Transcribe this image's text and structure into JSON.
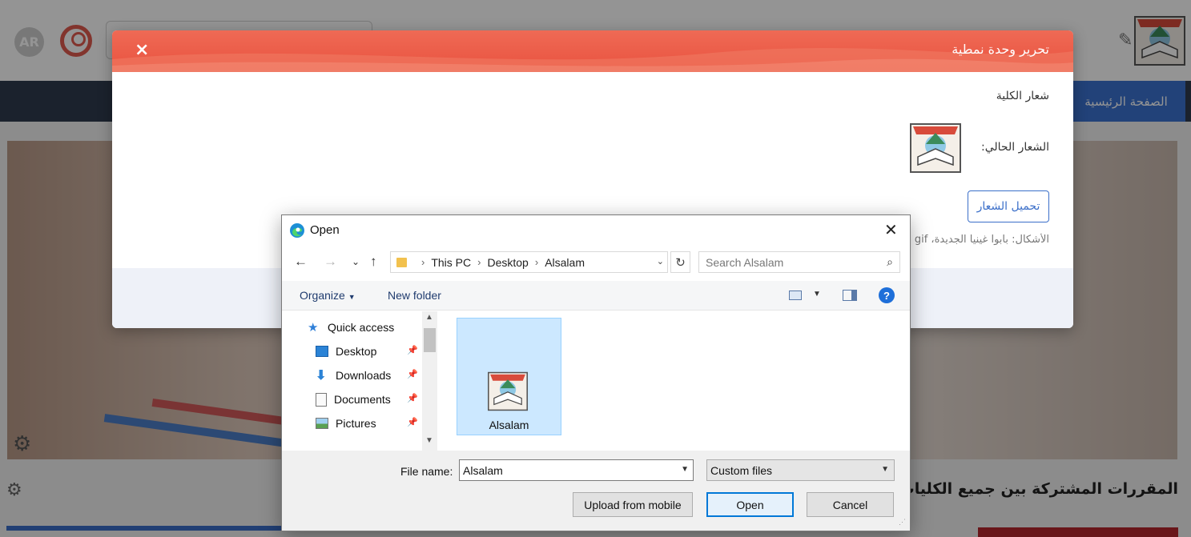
{
  "page": {
    "avatar_text": "AR",
    "nav_home": "الصفحة الرئيسية",
    "section_title": "المقررات المشتركة بين جميع الكليات (مطـ ... لية/ القسم"
  },
  "modal": {
    "close_glyph": "×",
    "title": "تحرير وحدة نمطية",
    "field_label": "شعار الكلية",
    "current_logo_label": "الشعار الحالي:",
    "upload_button": "تحميل الشعار",
    "formats_text": "الأشكال: بابوا غينيا الجديدة، gif"
  },
  "dialog": {
    "title": "Open",
    "address": [
      "This PC",
      "Desktop",
      "Alsalam"
    ],
    "search_placeholder": "Search Alsalam",
    "organize": "Organize",
    "new_folder": "New folder",
    "nav_items": [
      {
        "label": "Quick access",
        "icon": "star-icon",
        "pinned": false
      },
      {
        "label": "Desktop",
        "icon": "desktop-icon",
        "pinned": true
      },
      {
        "label": "Downloads",
        "icon": "download-icon",
        "pinned": true
      },
      {
        "label": "Documents",
        "icon": "documents-icon",
        "pinned": true
      },
      {
        "label": "Pictures",
        "icon": "pictures-icon",
        "pinned": true
      }
    ],
    "files": [
      {
        "name": "Alsalam",
        "selected": true
      }
    ],
    "file_name_label": "File name:",
    "file_name_value": "Alsalam",
    "file_type": "Custom files",
    "upload_mobile": "Upload from mobile",
    "open": "Open",
    "cancel": "Cancel"
  },
  "colors": {
    "modal_header": "#e9523f",
    "accent_blue": "#3b6fc9",
    "selection": "#cce8ff"
  }
}
